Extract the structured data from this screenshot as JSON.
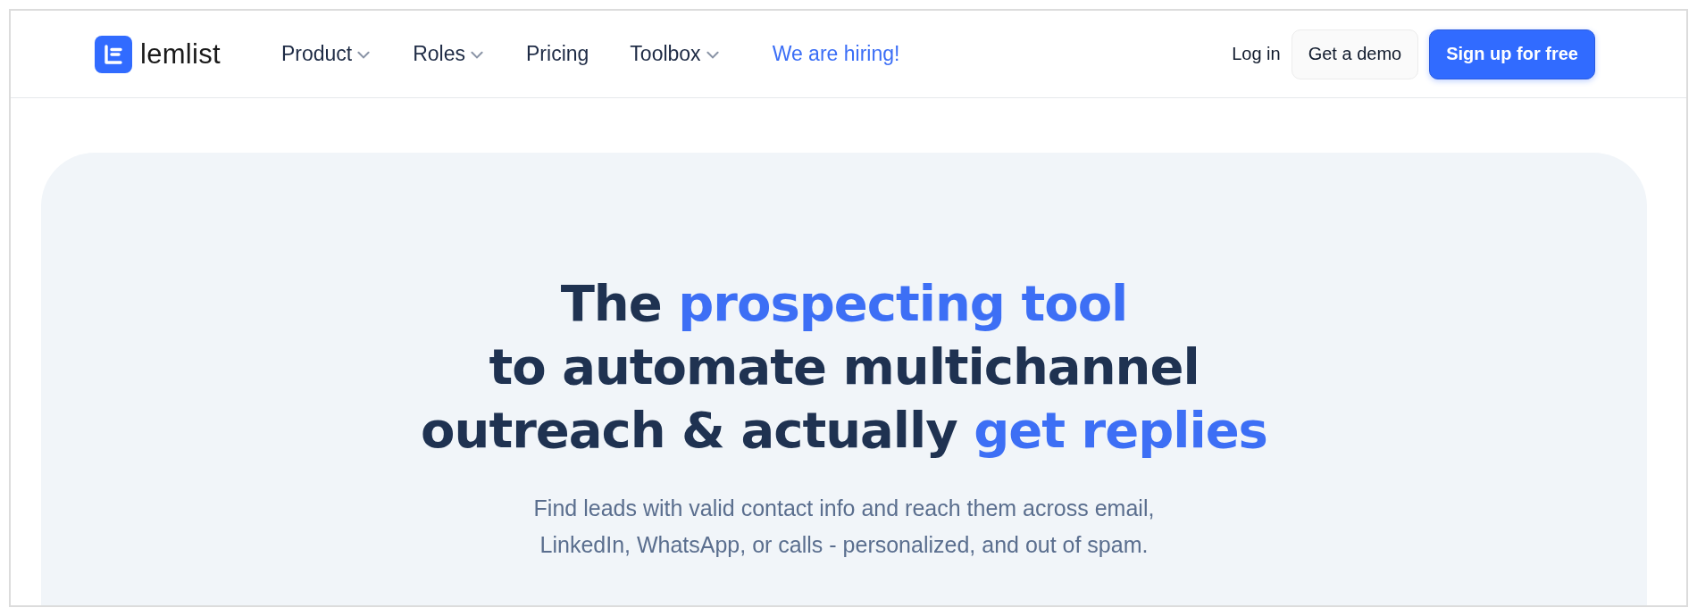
{
  "header": {
    "logo": {
      "text": "lemlist"
    },
    "nav": [
      {
        "label": "Product",
        "dropdown": true,
        "highlight": false
      },
      {
        "label": "Roles",
        "dropdown": true,
        "highlight": false
      },
      {
        "label": "Pricing",
        "dropdown": false,
        "highlight": false
      },
      {
        "label": "Toolbox",
        "dropdown": true,
        "highlight": false
      },
      {
        "label": "We are hiring!",
        "dropdown": false,
        "highlight": true
      }
    ],
    "actions": [
      {
        "label": "Log in",
        "kind": "link"
      },
      {
        "label": "Get a demo",
        "kind": "secondary"
      },
      {
        "label": "Sign up for free",
        "kind": "primary"
      }
    ]
  },
  "hero": {
    "headline": [
      [
        {
          "text": "The ",
          "highlight": false
        },
        {
          "text": "prospecting tool",
          "highlight": true
        }
      ],
      [
        {
          "text": "to automate multichannel",
          "highlight": false
        }
      ],
      [
        {
          "text": "outreach & actually ",
          "highlight": false
        },
        {
          "text": "get replies",
          "highlight": true
        }
      ]
    ],
    "subtitle": "Find leads with valid contact info and reach them across email, LinkedIn, WhatsApp, or calls - personalized, and out of spam."
  }
}
